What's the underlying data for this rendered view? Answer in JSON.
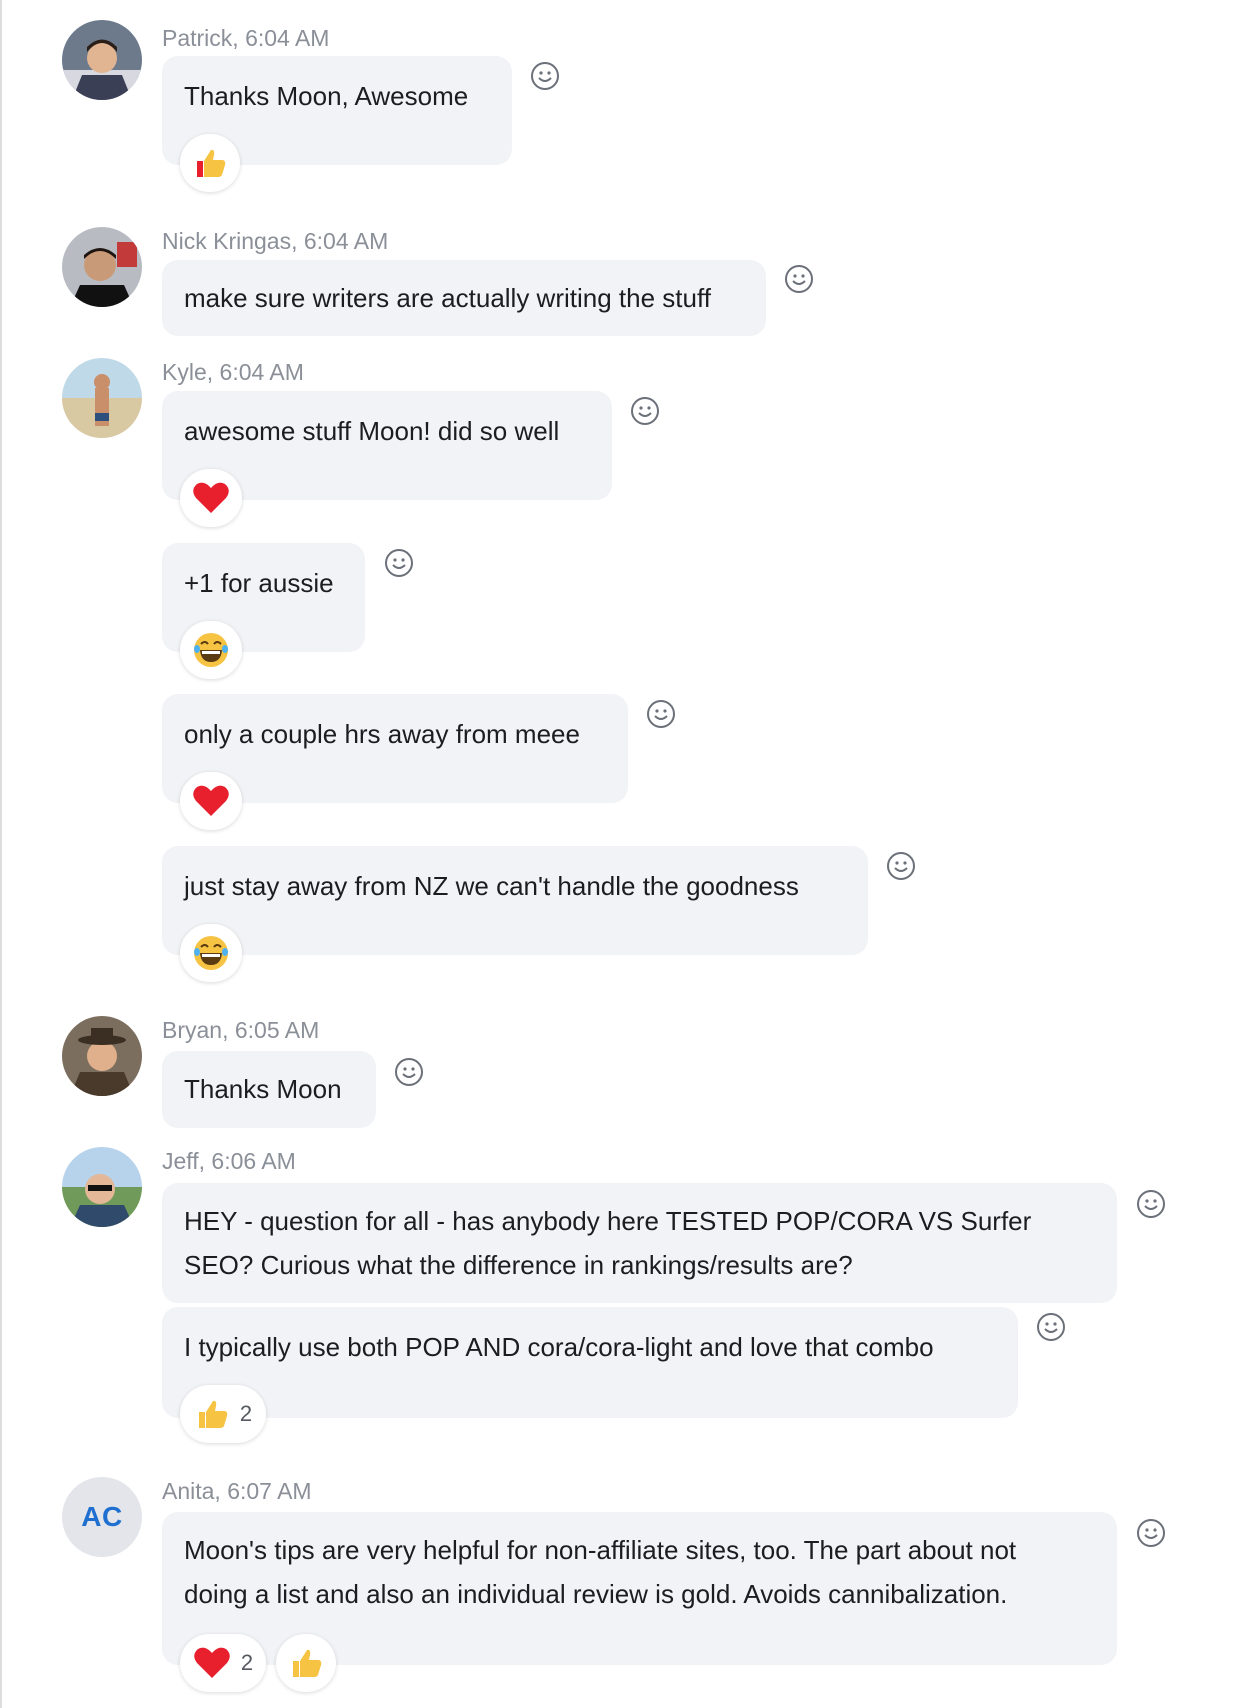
{
  "messages": [
    {
      "author_time": "Patrick, 6:04 AM",
      "text": "Thanks Moon, Awesome",
      "reactions": [
        {
          "icon": "thumbs-up-icon",
          "count": ""
        }
      ]
    },
    {
      "author_time": "Nick Kringas, 6:04 AM",
      "text": "make sure writers are actually writing the stuff",
      "reactions": []
    },
    {
      "author_time": "Kyle, 6:04 AM",
      "text": "awesome stuff Moon! did so well",
      "reactions": [
        {
          "icon": "heart-icon",
          "count": ""
        }
      ]
    },
    {
      "author_time": "",
      "text": "+1 for aussie",
      "reactions": [
        {
          "icon": "laughing-face-icon",
          "count": ""
        }
      ]
    },
    {
      "author_time": "",
      "text": "only a couple hrs away from meee",
      "reactions": [
        {
          "icon": "heart-icon",
          "count": ""
        }
      ]
    },
    {
      "author_time": "",
      "text": "just stay away from NZ we can't handle the goodness",
      "reactions": [
        {
          "icon": "laughing-face-icon",
          "count": ""
        }
      ]
    },
    {
      "author_time": "Bryan, 6:05 AM",
      "text": "Thanks Moon",
      "reactions": []
    },
    {
      "author_time": "Jeff, 6:06 AM",
      "text": "HEY - question for all - has anybody here TESTED POP/CORA VS Surfer\nSEO? Curious what the difference in rankings/results are?",
      "reactions": []
    },
    {
      "author_time": "",
      "text": "I typically use both POP AND cora/cora-light and love that combo",
      "reactions": [
        {
          "icon": "thumbs-up-icon",
          "count": "2"
        }
      ]
    },
    {
      "author_time": "Anita, 6:07 AM",
      "text": "Moon's tips are very helpful for non-affiliate sites, too.  The part about not\ndoing a list and also an individual review is gold.  Avoids cannibalization.",
      "reactions": [
        {
          "icon": "heart-icon",
          "count": "2"
        },
        {
          "icon": "thumbs-up-icon",
          "count": ""
        }
      ]
    }
  ],
  "avatars": {
    "anita_initials": "AC"
  },
  "colors": {
    "bubble": "#f1f3f6",
    "meta_text": "#8a8f98",
    "initials": "#1f6fd1",
    "heart": "#e8202e",
    "emoji_yellow": "#f6c343"
  }
}
